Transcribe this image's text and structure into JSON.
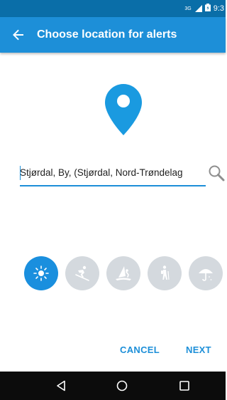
{
  "status_bar": {
    "network_label": "3G",
    "time": "9:3"
  },
  "app_bar": {
    "title": "Choose location for alerts",
    "back_icon": "arrow-back-icon"
  },
  "search": {
    "value": "Stjørdal, By, (Stjørdal, Nord-Trøndelag",
    "icon": "search-icon"
  },
  "activities": [
    {
      "icon": "sun-icon",
      "selected": true
    },
    {
      "icon": "skiing-icon",
      "selected": false
    },
    {
      "icon": "windsurf-icon",
      "selected": false
    },
    {
      "icon": "hiking-icon",
      "selected": false
    },
    {
      "icon": "umbrella-icon",
      "selected": false
    }
  ],
  "buttons": {
    "cancel": "CANCEL",
    "next": "NEXT"
  },
  "colors": {
    "primary": "#1d8fd8",
    "primary_dark": "#0a6ea8",
    "pin": "#1a9ae0",
    "inactive_circle": "#d4d9de"
  }
}
